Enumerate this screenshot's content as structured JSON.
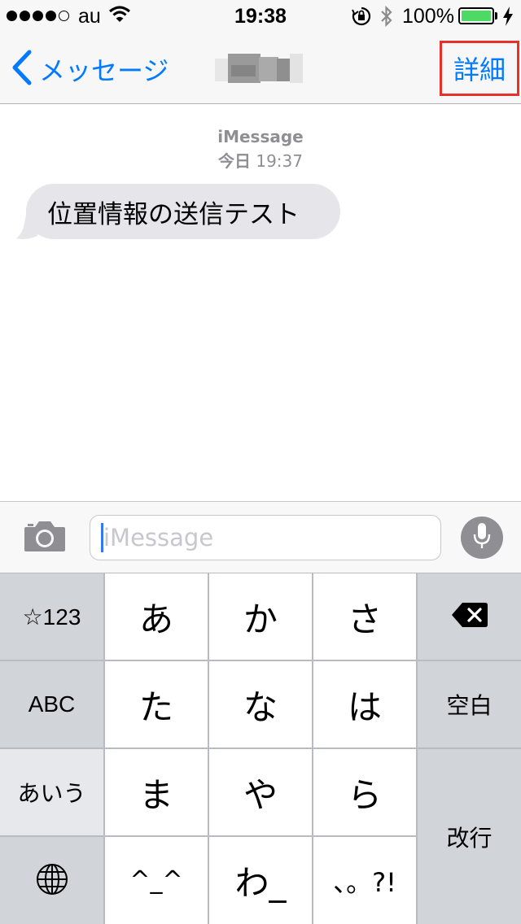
{
  "status_bar": {
    "carrier": "au",
    "time": "19:38",
    "battery_percent": "100%",
    "signal_strength": 4,
    "signal_max": 5,
    "battery_level": 1.0,
    "battery_color": "#4cd964",
    "icons": [
      "signal-dots-icon",
      "wifi-icon",
      "rotation-lock-icon",
      "bluetooth-icon",
      "battery-icon",
      "charging-bolt-icon"
    ]
  },
  "nav": {
    "back_label": "メッセージ",
    "back_icon": "chevron-left-icon",
    "detail_label": "詳細",
    "accent_color": "#007aff",
    "highlight_color": "#e8302b"
  },
  "conversation": {
    "service_label": "iMessage",
    "date_label": "今日",
    "time_label": "19:37",
    "messages": [
      {
        "direction": "incoming",
        "text": "位置情報の送信テスト"
      }
    ]
  },
  "input_bar": {
    "placeholder": "iMessage",
    "camera_icon": "camera-icon",
    "mic_icon": "microphone-icon"
  },
  "keyboard": {
    "left_column": [
      "☆123",
      "ABC",
      "あいう",
      "globe-icon"
    ],
    "rows": [
      [
        "あ",
        "か",
        "さ"
      ],
      [
        "た",
        "な",
        "は"
      ],
      [
        "ま",
        "や",
        "ら"
      ],
      [
        "^_^",
        "わ_",
        "、。?!"
      ]
    ],
    "delete_icon": "delete-icon",
    "space_label": "空白",
    "return_label": "改行"
  }
}
